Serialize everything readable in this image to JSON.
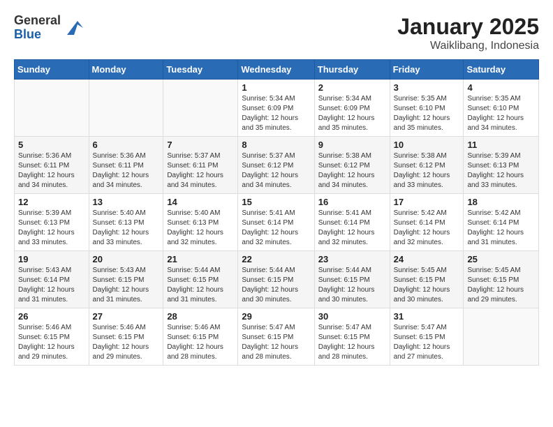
{
  "header": {
    "logo_general": "General",
    "logo_blue": "Blue",
    "month_title": "January 2025",
    "location": "Waiklibang, Indonesia"
  },
  "weekdays": [
    "Sunday",
    "Monday",
    "Tuesday",
    "Wednesday",
    "Thursday",
    "Friday",
    "Saturday"
  ],
  "weeks": [
    [
      {
        "day": "",
        "info": ""
      },
      {
        "day": "",
        "info": ""
      },
      {
        "day": "",
        "info": ""
      },
      {
        "day": "1",
        "info": "Sunrise: 5:34 AM\nSunset: 6:09 PM\nDaylight: 12 hours and 35 minutes."
      },
      {
        "day": "2",
        "info": "Sunrise: 5:34 AM\nSunset: 6:09 PM\nDaylight: 12 hours and 35 minutes."
      },
      {
        "day": "3",
        "info": "Sunrise: 5:35 AM\nSunset: 6:10 PM\nDaylight: 12 hours and 35 minutes."
      },
      {
        "day": "4",
        "info": "Sunrise: 5:35 AM\nSunset: 6:10 PM\nDaylight: 12 hours and 34 minutes."
      }
    ],
    [
      {
        "day": "5",
        "info": "Sunrise: 5:36 AM\nSunset: 6:11 PM\nDaylight: 12 hours and 34 minutes."
      },
      {
        "day": "6",
        "info": "Sunrise: 5:36 AM\nSunset: 6:11 PM\nDaylight: 12 hours and 34 minutes."
      },
      {
        "day": "7",
        "info": "Sunrise: 5:37 AM\nSunset: 6:11 PM\nDaylight: 12 hours and 34 minutes."
      },
      {
        "day": "8",
        "info": "Sunrise: 5:37 AM\nSunset: 6:12 PM\nDaylight: 12 hours and 34 minutes."
      },
      {
        "day": "9",
        "info": "Sunrise: 5:38 AM\nSunset: 6:12 PM\nDaylight: 12 hours and 34 minutes."
      },
      {
        "day": "10",
        "info": "Sunrise: 5:38 AM\nSunset: 6:12 PM\nDaylight: 12 hours and 33 minutes."
      },
      {
        "day": "11",
        "info": "Sunrise: 5:39 AM\nSunset: 6:13 PM\nDaylight: 12 hours and 33 minutes."
      }
    ],
    [
      {
        "day": "12",
        "info": "Sunrise: 5:39 AM\nSunset: 6:13 PM\nDaylight: 12 hours and 33 minutes."
      },
      {
        "day": "13",
        "info": "Sunrise: 5:40 AM\nSunset: 6:13 PM\nDaylight: 12 hours and 33 minutes."
      },
      {
        "day": "14",
        "info": "Sunrise: 5:40 AM\nSunset: 6:13 PM\nDaylight: 12 hours and 32 minutes."
      },
      {
        "day": "15",
        "info": "Sunrise: 5:41 AM\nSunset: 6:14 PM\nDaylight: 12 hours and 32 minutes."
      },
      {
        "day": "16",
        "info": "Sunrise: 5:41 AM\nSunset: 6:14 PM\nDaylight: 12 hours and 32 minutes."
      },
      {
        "day": "17",
        "info": "Sunrise: 5:42 AM\nSunset: 6:14 PM\nDaylight: 12 hours and 32 minutes."
      },
      {
        "day": "18",
        "info": "Sunrise: 5:42 AM\nSunset: 6:14 PM\nDaylight: 12 hours and 31 minutes."
      }
    ],
    [
      {
        "day": "19",
        "info": "Sunrise: 5:43 AM\nSunset: 6:14 PM\nDaylight: 12 hours and 31 minutes."
      },
      {
        "day": "20",
        "info": "Sunrise: 5:43 AM\nSunset: 6:15 PM\nDaylight: 12 hours and 31 minutes."
      },
      {
        "day": "21",
        "info": "Sunrise: 5:44 AM\nSunset: 6:15 PM\nDaylight: 12 hours and 31 minutes."
      },
      {
        "day": "22",
        "info": "Sunrise: 5:44 AM\nSunset: 6:15 PM\nDaylight: 12 hours and 30 minutes."
      },
      {
        "day": "23",
        "info": "Sunrise: 5:44 AM\nSunset: 6:15 PM\nDaylight: 12 hours and 30 minutes."
      },
      {
        "day": "24",
        "info": "Sunrise: 5:45 AM\nSunset: 6:15 PM\nDaylight: 12 hours and 30 minutes."
      },
      {
        "day": "25",
        "info": "Sunrise: 5:45 AM\nSunset: 6:15 PM\nDaylight: 12 hours and 29 minutes."
      }
    ],
    [
      {
        "day": "26",
        "info": "Sunrise: 5:46 AM\nSunset: 6:15 PM\nDaylight: 12 hours and 29 minutes."
      },
      {
        "day": "27",
        "info": "Sunrise: 5:46 AM\nSunset: 6:15 PM\nDaylight: 12 hours and 29 minutes."
      },
      {
        "day": "28",
        "info": "Sunrise: 5:46 AM\nSunset: 6:15 PM\nDaylight: 12 hours and 28 minutes."
      },
      {
        "day": "29",
        "info": "Sunrise: 5:47 AM\nSunset: 6:15 PM\nDaylight: 12 hours and 28 minutes."
      },
      {
        "day": "30",
        "info": "Sunrise: 5:47 AM\nSunset: 6:15 PM\nDaylight: 12 hours and 28 minutes."
      },
      {
        "day": "31",
        "info": "Sunrise: 5:47 AM\nSunset: 6:15 PM\nDaylight: 12 hours and 27 minutes."
      },
      {
        "day": "",
        "info": ""
      }
    ]
  ]
}
